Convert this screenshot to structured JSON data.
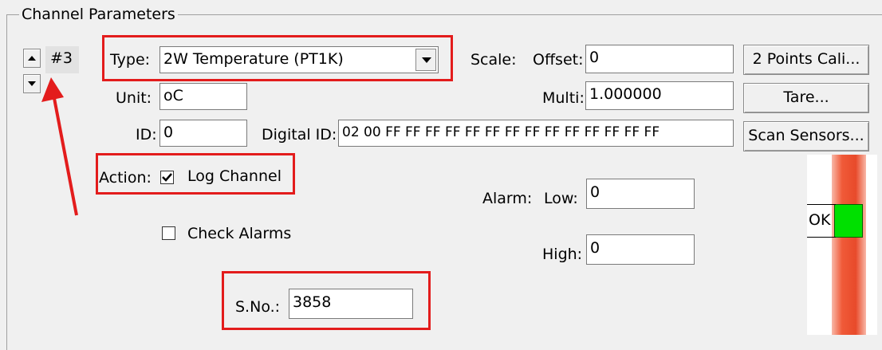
{
  "group": {
    "title": "Channel Parameters"
  },
  "channel": {
    "number": "#3"
  },
  "type": {
    "label": "Type:",
    "value": "2W Temperature (PT1K)"
  },
  "unit": {
    "label": "Unit:",
    "value": "oC"
  },
  "id": {
    "label": "ID:",
    "value": "0"
  },
  "digital_id": {
    "label": "Digital ID:",
    "value": "02 00 FF FF FF FF FF FF FF FF FF FF FF FF FF FF"
  },
  "scale": {
    "label": "Scale:",
    "offset_label": "Offset:",
    "offset_value": "0",
    "multi_label": "Multi:",
    "multi_value": "1.000000"
  },
  "buttons": {
    "cali": "2 Points Cali...",
    "tare": "Tare...",
    "scan": "Scan Sensors..."
  },
  "action": {
    "label": "Action:",
    "log_label": "Log Channel",
    "log_checked": true
  },
  "check_alarms": {
    "label": "Check Alarms",
    "checked": false
  },
  "alarm": {
    "label": "Alarm:",
    "low_label": "Low:",
    "low_value": "0",
    "high_label": "High:",
    "high_value": "0"
  },
  "status": {
    "label": "OK"
  },
  "sno": {
    "label": "S.No.:",
    "value": "3858"
  },
  "colors": {
    "annotation": "#e31c1c",
    "alarm_bar": "#f05a38",
    "ok": "#00e000"
  }
}
